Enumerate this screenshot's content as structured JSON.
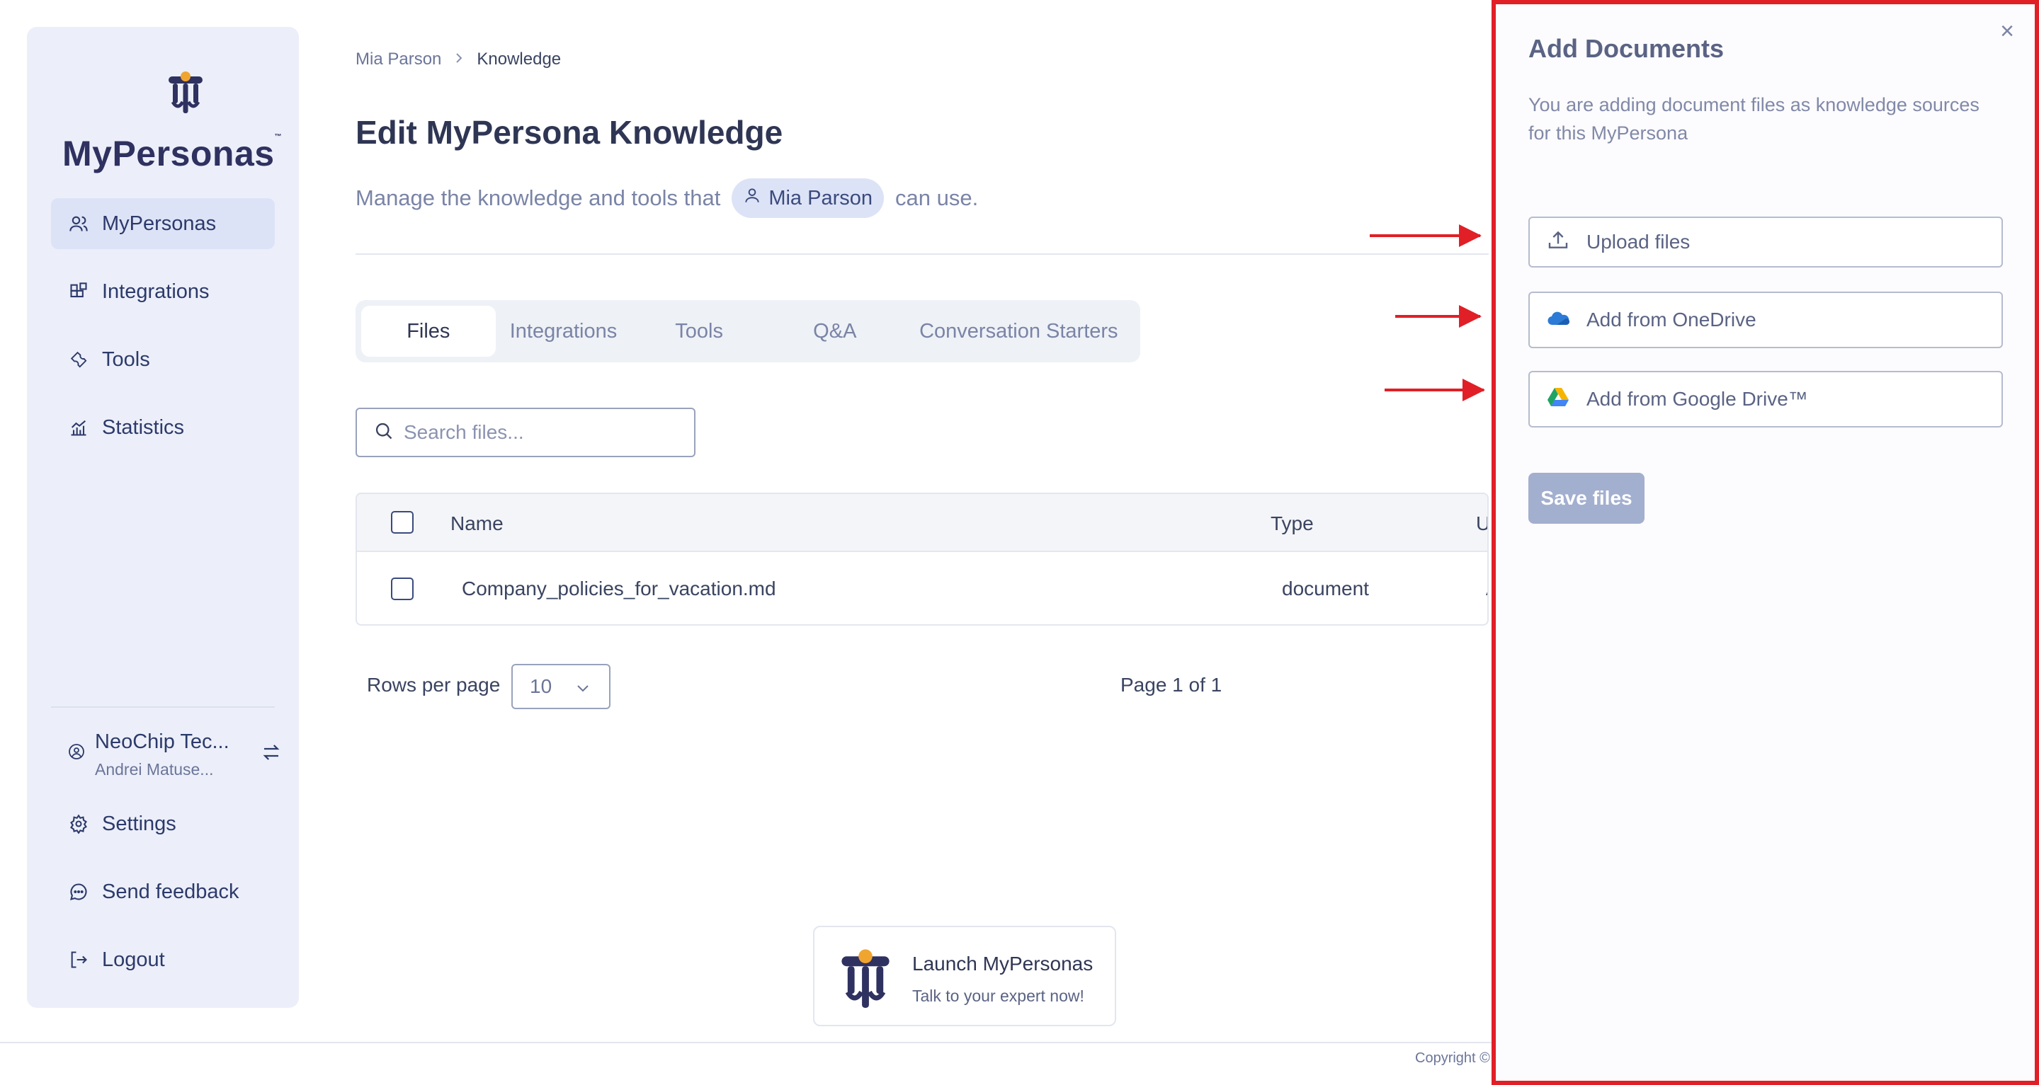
{
  "sidebar": {
    "logo_text": "MyPersonas",
    "logo_tm": "™",
    "nav": [
      {
        "label": "MyPersonas",
        "icon": "users-icon",
        "active": true
      },
      {
        "label": "Integrations",
        "icon": "integrations-icon"
      },
      {
        "label": "Tools",
        "icon": "wrench-icon"
      },
      {
        "label": "Statistics",
        "icon": "chart-icon"
      }
    ],
    "org": {
      "name": "NeoChip Tec...",
      "user": "Andrei Matuse..."
    },
    "bottom": [
      {
        "label": "Settings",
        "icon": "gear-icon"
      },
      {
        "label": "Send feedback",
        "icon": "chat-icon"
      },
      {
        "label": "Logout",
        "icon": "logout-icon"
      }
    ]
  },
  "breadcrumb": {
    "parent": "Mia Parson",
    "current": "Knowledge"
  },
  "page": {
    "title": "Edit MyPersona Knowledge",
    "subtitle_before": "Manage the knowledge and tools that",
    "persona": "Mia Parson",
    "subtitle_after": "can use."
  },
  "tabs": [
    "Files",
    "Integrations",
    "Tools",
    "Q&A",
    "Conversation Starters"
  ],
  "search": {
    "placeholder": "Search files..."
  },
  "table": {
    "columns": {
      "name": "Name",
      "type": "Type",
      "u": "U"
    },
    "rows": [
      {
        "name": "Company_policies_for_vacation.md",
        "type": "document",
        "u": "A"
      }
    ]
  },
  "pagination": {
    "rows_label": "Rows per page",
    "rows_value": "10",
    "page_info": "Page 1 of 1"
  },
  "launch": {
    "title": "Launch MyPersonas",
    "subtitle": "Talk to your expert now!"
  },
  "footer": {
    "copyright": "Copyright ©"
  },
  "panel": {
    "title": "Add Documents",
    "description": "You are adding document files as knowledge sources for this MyPersona",
    "close": "×",
    "upload": "Upload files",
    "onedrive": "Add from OneDrive",
    "gdrive": "Add from Google Drive™",
    "save": "Save files"
  },
  "colors": {
    "accent": "#2c3a6b",
    "highlight": "#e11f26",
    "brand_orange": "#f0a531"
  }
}
